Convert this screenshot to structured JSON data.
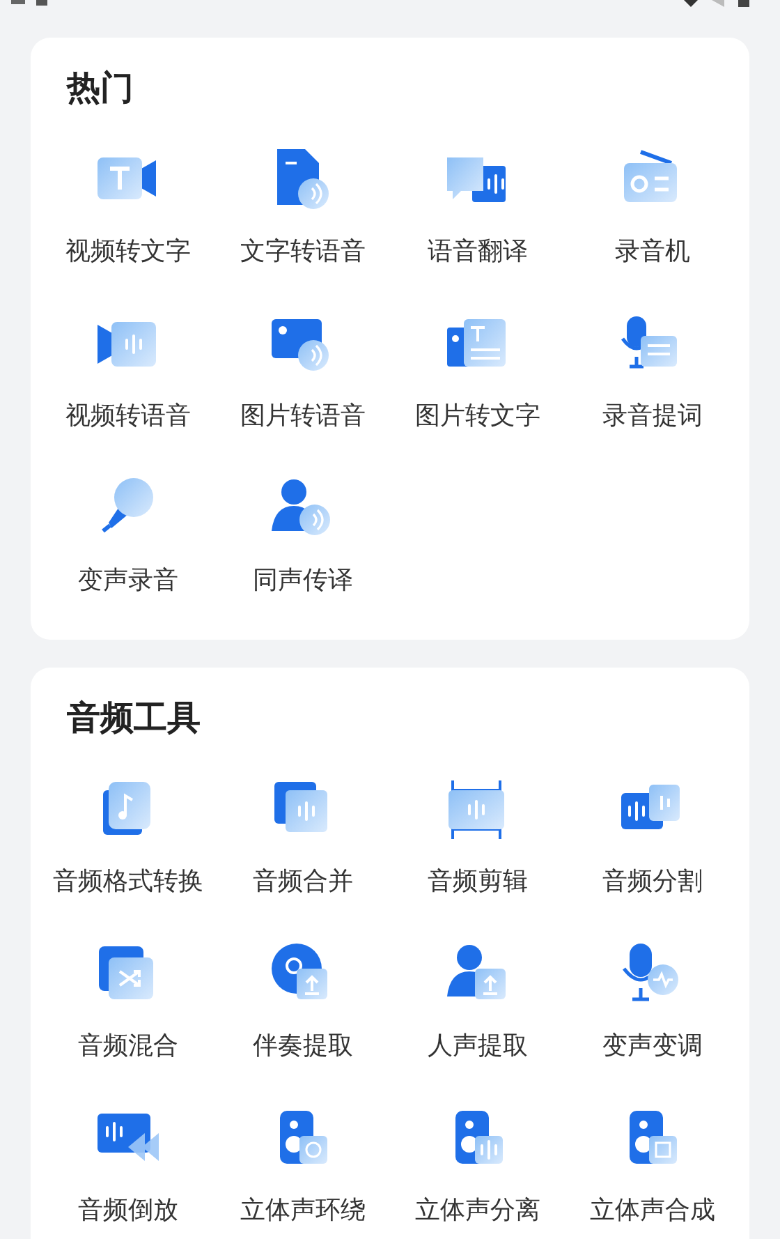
{
  "sections": [
    {
      "title": "热门",
      "items": [
        {
          "label": "视频转文字"
        },
        {
          "label": "文字转语音"
        },
        {
          "label": "语音翻译"
        },
        {
          "label": "录音机"
        },
        {
          "label": "视频转语音"
        },
        {
          "label": "图片转语音"
        },
        {
          "label": "图片转文字"
        },
        {
          "label": "录音提词"
        },
        {
          "label": "变声录音"
        },
        {
          "label": "同声传译"
        }
      ]
    },
    {
      "title": "音频工具",
      "items": [
        {
          "label": "音频格式转换"
        },
        {
          "label": "音频合并"
        },
        {
          "label": "音频剪辑"
        },
        {
          "label": "音频分割"
        },
        {
          "label": "音频混合"
        },
        {
          "label": "伴奏提取"
        },
        {
          "label": "人声提取"
        },
        {
          "label": "变声变调"
        },
        {
          "label": "音频倒放"
        },
        {
          "label": "立体声环绕"
        },
        {
          "label": "立体声分离"
        },
        {
          "label": "立体声合成"
        }
      ]
    }
  ]
}
